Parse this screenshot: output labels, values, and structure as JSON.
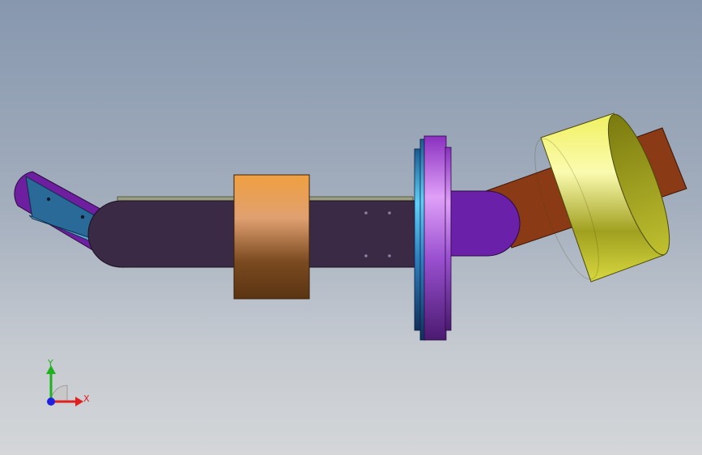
{
  "viewport": {
    "background_top": "#8797ae",
    "background_bottom": "#d4d6d8"
  },
  "model": {
    "parts": [
      {
        "name": "left-bracket-arm",
        "color": "#6e1fa0"
      },
      {
        "name": "left-blade-plate",
        "color": "#2a6a99"
      },
      {
        "name": "main-shaft",
        "color": "#3a2a45"
      },
      {
        "name": "orange-collar",
        "color": "#c87a30"
      },
      {
        "name": "flange-disc-blue",
        "color": "#2f8fd0"
      },
      {
        "name": "flange-disc-purple",
        "color": "#a040e0"
      },
      {
        "name": "purple-joint",
        "color": "#6a20a8"
      },
      {
        "name": "brown-arm",
        "color": "#8a3a14"
      },
      {
        "name": "yellow-wheel",
        "color": "#e6e030"
      }
    ]
  },
  "triad": {
    "x_label": "X",
    "y_label": "Y",
    "x_color": "#e02020",
    "y_color": "#20b020",
    "z_color": "#2020e0"
  }
}
